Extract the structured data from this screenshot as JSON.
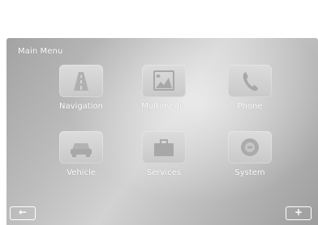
{
  "screen": {
    "title": "Main Menu"
  },
  "menu": {
    "items": [
      {
        "label": "Navigation",
        "icon": "navigation-road-icon"
      },
      {
        "label": "Multimedia",
        "icon": "multimedia-icon"
      },
      {
        "label": "Phone",
        "icon": "phone-icon"
      },
      {
        "label": "Vehicle",
        "icon": "vehicle-icon"
      },
      {
        "label": "Services",
        "icon": "services-icon"
      },
      {
        "label": "System",
        "icon": "system-icon"
      }
    ]
  },
  "footer": {
    "back_label": "←",
    "add_label": "+"
  }
}
